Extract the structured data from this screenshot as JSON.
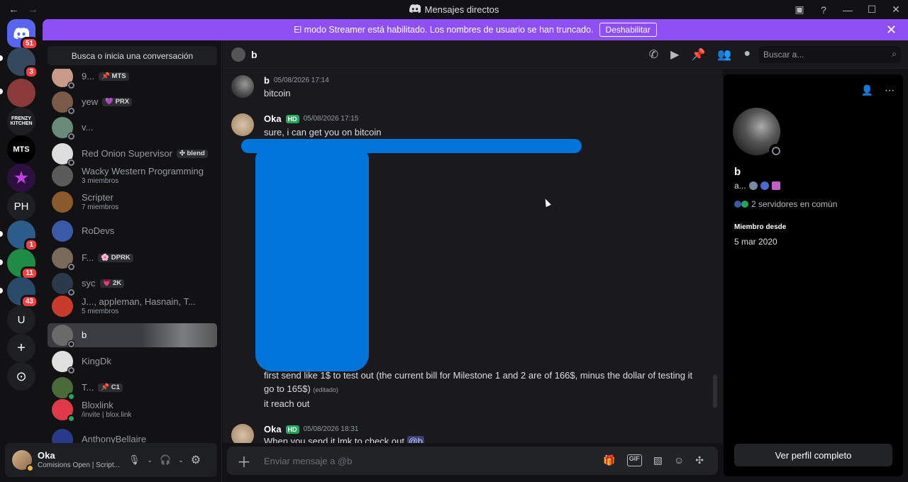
{
  "titlebar": {
    "title": "Mensajes directos",
    "back": "←",
    "forward": "→"
  },
  "rail": {
    "items": [
      {
        "label": "",
        "badge": "51",
        "color": "#5865f2"
      },
      {
        "label": "",
        "badge": "3",
        "color": "#34495e"
      },
      {
        "label": "",
        "badge": "",
        "color": "#8b3a3a"
      },
      {
        "label": "FRENZY KITCHEN",
        "badge": "",
        "color": "#1e1f22"
      },
      {
        "label": "MTS",
        "badge": "",
        "color": "#000000"
      },
      {
        "label": "★",
        "badge": "",
        "color": "#2b1040"
      },
      {
        "label": "PH",
        "badge": "",
        "color": "#1e1f22"
      },
      {
        "label": "",
        "badge": "1",
        "color": "#2c5d8a"
      },
      {
        "label": "",
        "badge": "11",
        "color": "#1e8c45"
      },
      {
        "label": "",
        "badge": "43",
        "color": "#2a4a6a"
      },
      {
        "label": "U",
        "badge": "",
        "color": "#1e1f22"
      },
      {
        "label": "+",
        "badge": "",
        "color": "#1e1f22"
      },
      {
        "label": "⊙",
        "badge": "",
        "color": "#1e1f22"
      }
    ]
  },
  "banner": {
    "text": "El modo Streamer está habilitado. Los nombres de usuario se han truncado.",
    "button": "Deshabilitar"
  },
  "dm_sidebar": {
    "search": "Busca o inicia una conversación",
    "items": [
      {
        "name": "9...",
        "tag": "📌 MTS",
        "sub": "",
        "status": "off",
        "color": "#c89a8a"
      },
      {
        "name": "yew",
        "tag": "💜 PRX",
        "sub": "",
        "status": "off",
        "color": "#7a5a4a"
      },
      {
        "name": "v...",
        "tag": "",
        "sub": "",
        "status": "off",
        "color": "#6a8a7a"
      },
      {
        "name": "Red Onion Supervisor",
        "tag": "✣ blend",
        "sub": "",
        "status": "off",
        "color": "#dddddd"
      },
      {
        "name": "Wacky Western Programming",
        "tag": "",
        "sub": "3 miembros",
        "status": "",
        "color": "#5a5a5a"
      },
      {
        "name": "Scripter",
        "tag": "",
        "sub": "7 miembros",
        "status": "",
        "color": "#8a5a2a"
      },
      {
        "name": "RoDevs",
        "tag": "",
        "sub": "",
        "status": "",
        "color": "#3a5aa8"
      },
      {
        "name": "F...",
        "tag": "🌸 DPRK",
        "sub": "",
        "status": "off",
        "color": "#7a6a5a"
      },
      {
        "name": "syc",
        "tag": "💗 2K",
        "sub": "",
        "status": "off",
        "color": "#2a3a4a"
      },
      {
        "name": "J..., appleman, Hasnain, T...",
        "tag": "",
        "sub": "5 miembros",
        "status": "",
        "color": "#c83a2a"
      },
      {
        "name": "b",
        "tag": "",
        "sub": "",
        "status": "off",
        "color": "#6a6a6a"
      },
      {
        "name": "KingDk",
        "tag": "",
        "sub": "",
        "status": "off",
        "color": "#e0e0e0"
      },
      {
        "name": "T...",
        "tag": "📌 C1",
        "sub": "",
        "status": "on",
        "color": "#4a6a3a"
      },
      {
        "name": "Bloxlink",
        "tag": "",
        "sub": "/invite | blox.link",
        "status": "on",
        "color": "#e03a4a"
      },
      {
        "name": "AnthonyBellaire",
        "tag": "",
        "sub": "",
        "status": "",
        "color": "#2a3a8a"
      }
    ]
  },
  "user_panel": {
    "name": "Oka",
    "status": "Comisions Open | Script..."
  },
  "chat_header": {
    "name": "b",
    "search_placeholder": "Buscar a..."
  },
  "messages": [
    {
      "author": "b",
      "time": "05/08/2026 17:14",
      "hd": "",
      "text": "bitcoin"
    },
    {
      "author": "Oka",
      "time": "05/08/2026 17:15",
      "hd": "HD",
      "text": "sure, i can get you on bitcoin"
    },
    {
      "line1": "first send like 1$ to test out (the current bill for Milestone 1 and 2 are of 166$, minus the dollar of testing it",
      "line2": "go to 165$)",
      "edited": "(editado)",
      "line3": "it reach out"
    },
    {
      "author": "Oka",
      "time": "05/08/2026 18:31",
      "hd": "HD",
      "text": "When you send it lmk to check out",
      "mention": "@b"
    }
  ],
  "composer": {
    "placeholder": "Enviar mensaje a @b"
  },
  "profile": {
    "name": "b",
    "tag": "a...",
    "mutual": "2 servidores en común",
    "since_label": "Miembro desde",
    "since_value": "5 mar 2020",
    "button": "Ver perfil completo"
  }
}
